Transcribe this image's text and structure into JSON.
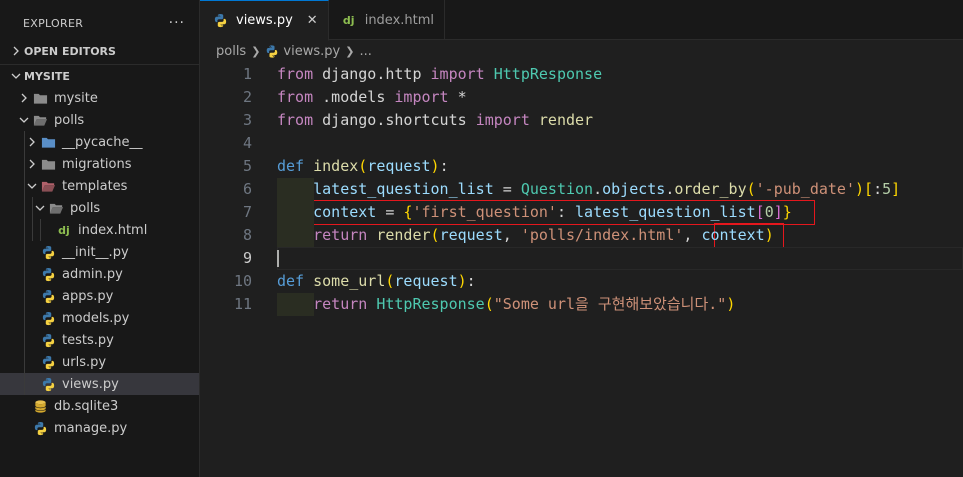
{
  "sidebar": {
    "title": "EXPLORER",
    "more": "···",
    "open_editors": "OPEN EDITORS",
    "root": "MYSITE",
    "items": [
      {
        "label": "mysite",
        "type": "folder",
        "depth": 1,
        "expanded": false
      },
      {
        "label": "polls",
        "type": "folder-open",
        "depth": 1,
        "expanded": true
      },
      {
        "label": "__pycache__",
        "type": "folder-pycache",
        "depth": 2,
        "expanded": false
      },
      {
        "label": "migrations",
        "type": "folder",
        "depth": 2,
        "expanded": false
      },
      {
        "label": "templates",
        "type": "folder-open-red",
        "depth": 2,
        "expanded": true
      },
      {
        "label": "polls",
        "type": "folder-open",
        "depth": 3,
        "expanded": true
      },
      {
        "label": "index.html",
        "type": "django",
        "depth": 4
      },
      {
        "label": "__init__.py",
        "type": "python",
        "depth": 2
      },
      {
        "label": "admin.py",
        "type": "python",
        "depth": 2
      },
      {
        "label": "apps.py",
        "type": "python",
        "depth": 2
      },
      {
        "label": "models.py",
        "type": "python",
        "depth": 2
      },
      {
        "label": "tests.py",
        "type": "python",
        "depth": 2
      },
      {
        "label": "urls.py",
        "type": "python",
        "depth": 2
      },
      {
        "label": "views.py",
        "type": "python",
        "depth": 2,
        "selected": true
      },
      {
        "label": "db.sqlite3",
        "type": "database",
        "depth": 1
      },
      {
        "label": "manage.py",
        "type": "python",
        "depth": 1
      }
    ]
  },
  "tabs": [
    {
      "label": "views.py",
      "icon": "python-icon",
      "active": true,
      "close": "✕"
    },
    {
      "label": "index.html",
      "icon": "django-icon",
      "active": false
    }
  ],
  "django_icon_text": "dj",
  "breadcrumb": {
    "folder": "polls",
    "file": "views.py",
    "more": "..."
  },
  "code_lines": [
    {
      "n": "1",
      "tokens": [
        [
          "kw",
          "from "
        ],
        [
          "op",
          "django.http "
        ],
        [
          "kw",
          "import "
        ],
        [
          "cls",
          "HttpResponse"
        ]
      ]
    },
    {
      "n": "2",
      "tokens": [
        [
          "kw",
          "from "
        ],
        [
          "op",
          ".models "
        ],
        [
          "kw",
          "import "
        ],
        [
          "op",
          "*"
        ]
      ]
    },
    {
      "n": "3",
      "tokens": [
        [
          "kw",
          "from "
        ],
        [
          "op",
          "django.shortcuts "
        ],
        [
          "kw",
          "import "
        ],
        [
          "fn",
          "render"
        ]
      ]
    },
    {
      "n": "4",
      "tokens": []
    },
    {
      "n": "5",
      "tokens": [
        [
          "def",
          "def "
        ],
        [
          "fn",
          "index"
        ],
        [
          "br1",
          "("
        ],
        [
          "var",
          "request"
        ],
        [
          "br1",
          ")"
        ],
        [
          "op",
          ":"
        ]
      ]
    },
    {
      "n": "6",
      "indent": true,
      "tokens": [
        [
          "op",
          "    "
        ],
        [
          "var",
          "latest_question_list"
        ],
        [
          "op",
          " = "
        ],
        [
          "cls",
          "Question"
        ],
        [
          "op",
          "."
        ],
        [
          "var",
          "objects"
        ],
        [
          "op",
          "."
        ],
        [
          "fn",
          "order_by"
        ],
        [
          "br1",
          "("
        ],
        [
          "str",
          "'-pub_date'"
        ],
        [
          "br1",
          ")"
        ],
        [
          "br1",
          "["
        ],
        [
          "op",
          ":"
        ],
        [
          "num",
          "5"
        ],
        [
          "br1",
          "]"
        ]
      ]
    },
    {
      "n": "7",
      "indent": true,
      "tokens": [
        [
          "op",
          "    "
        ],
        [
          "var",
          "context"
        ],
        [
          "op",
          " = "
        ],
        [
          "br1",
          "{"
        ],
        [
          "str",
          "'first_question'"
        ],
        [
          "op",
          ": "
        ],
        [
          "var",
          "latest_question_list"
        ],
        [
          "br2",
          "["
        ],
        [
          "num",
          "0"
        ],
        [
          "br2",
          "]"
        ],
        [
          "br1",
          "}"
        ]
      ]
    },
    {
      "n": "8",
      "indent": true,
      "tokens": [
        [
          "op",
          "    "
        ],
        [
          "kw",
          "return "
        ],
        [
          "fn",
          "render"
        ],
        [
          "br1",
          "("
        ],
        [
          "var",
          "request"
        ],
        [
          "op",
          ", "
        ],
        [
          "str",
          "'polls/index.html'"
        ],
        [
          "op",
          ", "
        ],
        [
          "var",
          "context"
        ],
        [
          "br1",
          ")"
        ]
      ]
    },
    {
      "n": "9",
      "current": true,
      "tokens": []
    },
    {
      "n": "10",
      "tokens": [
        [
          "def",
          "def "
        ],
        [
          "fn",
          "some_url"
        ],
        [
          "br1",
          "("
        ],
        [
          "var",
          "request"
        ],
        [
          "br1",
          ")"
        ],
        [
          "op",
          ":"
        ]
      ]
    },
    {
      "n": "11",
      "indent": true,
      "tokens": [
        [
          "op",
          "    "
        ],
        [
          "kw",
          "return "
        ],
        [
          "cls",
          "HttpResponse"
        ],
        [
          "br1",
          "("
        ],
        [
          "str",
          "\"Some url을 구현해보았습니다.\""
        ],
        [
          "br1",
          ")"
        ]
      ]
    }
  ],
  "colors": {
    "accent": "#0078d4",
    "highlight_box": "#e5171d"
  }
}
